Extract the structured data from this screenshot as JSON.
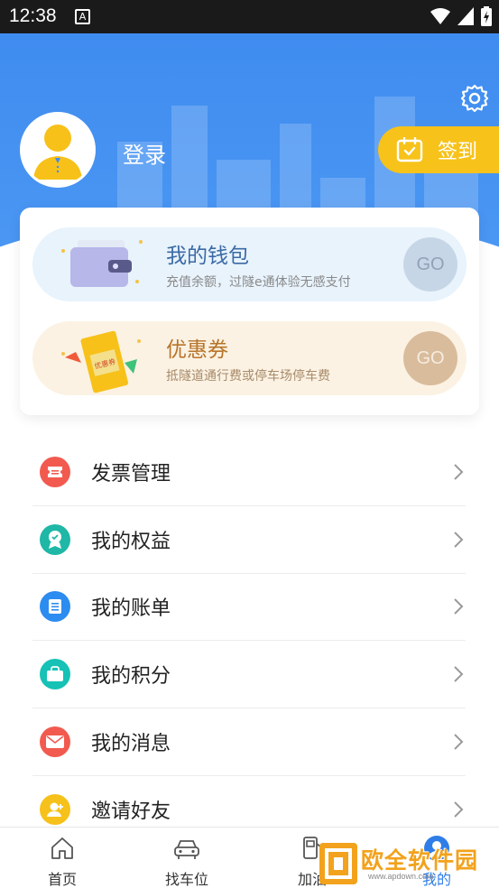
{
  "status_bar": {
    "time": "12:38",
    "a_badge": "A"
  },
  "header": {
    "login_label": "登录",
    "checkin_label": "签到"
  },
  "wallet_card": {
    "title": "我的钱包",
    "subtitle": "充值余额，过隧e通体验无感支付",
    "go_label": "GO"
  },
  "coupon_card": {
    "title": "优惠券",
    "subtitle": "抵隧道通行费或停车场停车费",
    "go_label": "GO",
    "ticket_text": "优惠券"
  },
  "menu": {
    "items": [
      {
        "label": "发票管理",
        "icon": "invoice-icon",
        "color": "#f25a4f"
      },
      {
        "label": "我的权益",
        "icon": "rights-icon",
        "color": "#1fb7a6"
      },
      {
        "label": "我的账单",
        "icon": "bill-icon",
        "color": "#2c8cf0"
      },
      {
        "label": "我的积分",
        "icon": "points-icon",
        "color": "#15c2b5"
      },
      {
        "label": "我的消息",
        "icon": "message-icon",
        "color": "#f25a4f"
      },
      {
        "label": "邀请好友",
        "icon": "invite-icon",
        "color": "#f6c11a"
      }
    ]
  },
  "bottom_nav": {
    "items": [
      {
        "label": "首页",
        "icon": "home-icon"
      },
      {
        "label": "找车位",
        "icon": "car-icon"
      },
      {
        "label": "加油",
        "icon": "fuel-icon"
      },
      {
        "label": "我的",
        "icon": "profile-icon",
        "active": true
      }
    ]
  },
  "watermark": {
    "text": "欧全软件园",
    "url": "www.apdown.com"
  },
  "colors": {
    "header_blue": "#4591f2",
    "accent_yellow": "#f7c21a",
    "active_blue": "#2f7ee8"
  }
}
